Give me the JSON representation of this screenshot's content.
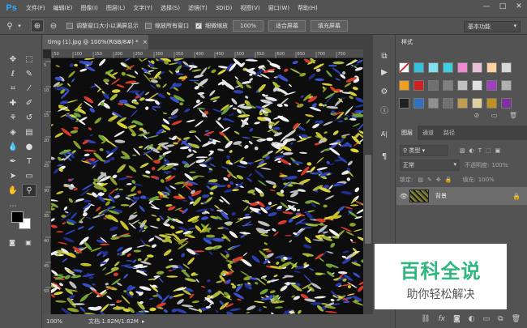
{
  "app": {
    "logo": "Ps"
  },
  "menu": [
    "文件(F)",
    "编辑(E)",
    "图像(I)",
    "图层(L)",
    "文字(Y)",
    "选择(S)",
    "滤镜(T)",
    "3D(D)",
    "视图(V)",
    "窗口(W)",
    "帮助(H)"
  ],
  "window_controls": {
    "minimize": "—",
    "restore": "□",
    "close": "✕"
  },
  "options": {
    "resize_windows": "调整窗口大小以满屏显示",
    "zoom_all": "缩放所有窗口",
    "scrubby_zoom": "细微缩放",
    "btn_100": "100%",
    "btn_fit": "适合屏幕",
    "btn_fill": "填充屏幕",
    "workspace": "基本功能"
  },
  "document": {
    "tab_title": "timg (1).jpg @ 100%(RGB/8#) *",
    "tab_close": "×",
    "zoom": "100%",
    "doc_info": "文档:1.82M/1.82M"
  },
  "ruler": {
    "h_ticks": [
      "50",
      "100",
      "150",
      "200",
      "250",
      "300",
      "350",
      "400",
      "450",
      "500",
      "550",
      "600",
      "650",
      "700",
      "750"
    ],
    "v_ticks": [
      "5",
      "10",
      "15",
      "20",
      "25",
      "30",
      "35",
      "40",
      "45",
      "50"
    ]
  },
  "swatches_panel": {
    "tab": "样式"
  },
  "layers_panel": {
    "tabs": [
      "图层",
      "通道",
      "路径"
    ],
    "kind_label": "类型",
    "blend_mode": "正常",
    "opacity_label": "不透明度:",
    "opacity_value": "100%",
    "lock_label": "锁定:",
    "fill_label": "填充:",
    "fill_value": "100%",
    "layer_name": "背景",
    "bottom_icons": [
      "link-icon",
      "fx",
      "mask-icon",
      "adjust-icon",
      "folder-icon",
      "new-layer-icon",
      "trash-icon"
    ]
  },
  "watermark": {
    "line1": "百科全说",
    "line2": "助你轻松解决"
  }
}
